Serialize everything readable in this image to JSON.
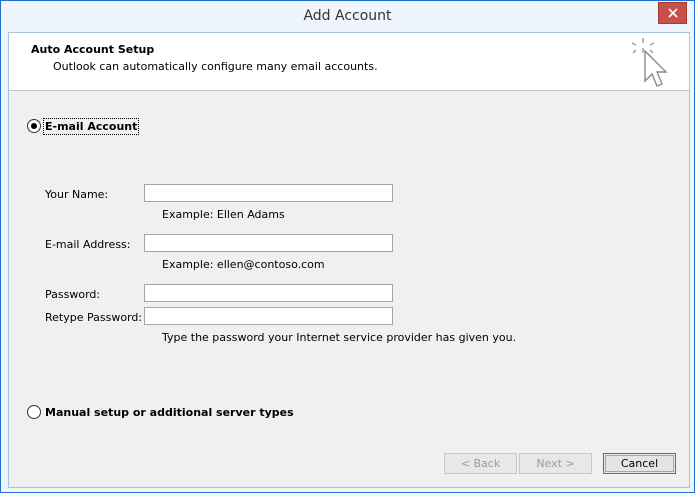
{
  "window": {
    "title": "Add Account"
  },
  "header": {
    "title": "Auto Account Setup",
    "subtitle": "Outlook can automatically configure many email accounts."
  },
  "options": {
    "email_account": "E-mail Account",
    "manual_setup": "Manual setup or additional server types"
  },
  "form": {
    "name_label": "Your Name:",
    "name_value": "",
    "name_hint": "Example: Ellen Adams",
    "email_label": "E-mail Address:",
    "email_value": "",
    "email_hint": "Example: ellen@contoso.com",
    "password_label": "Password:",
    "retype_label": "Retype Password:",
    "password_hint": "Type the password your Internet service provider has given you."
  },
  "buttons": {
    "back": "< Back",
    "next": "Next >",
    "cancel": "Cancel"
  }
}
